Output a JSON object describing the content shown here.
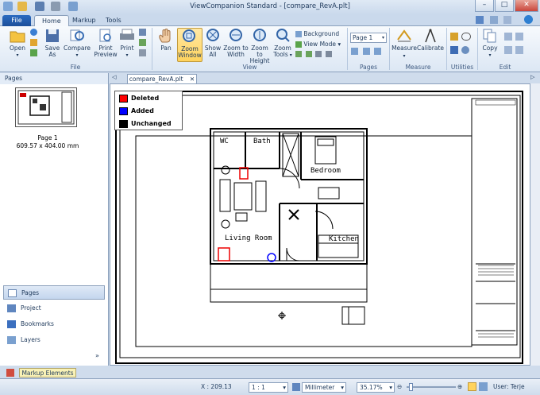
{
  "window": {
    "title": "ViewCompanion Standard - [compare_RevA.plt]"
  },
  "tabs": {
    "file": "File",
    "home": "Home",
    "markup": "Markup",
    "tools": "Tools"
  },
  "ribbon": {
    "file_group": {
      "label": "File",
      "open": "Open",
      "save_as": "Save As",
      "compare": "Compare",
      "print_preview": "Print Preview",
      "print": "Print"
    },
    "view_group": {
      "label": "View",
      "pan": "Pan",
      "zoom_window": "Zoom Window",
      "show_all": "Show All",
      "zoom_to_width": "Zoom to Width",
      "zoom_to_height": "Zoom to Height",
      "zoom_tools": "Zoom Tools",
      "background": "Background",
      "view_mode": "View Mode"
    },
    "pages_group": {
      "label": "Pages",
      "page_select": "Page 1"
    },
    "measure_group": {
      "label": "Measure",
      "measure": "Measure",
      "calibrate": "Calibrate"
    },
    "utilities_group": {
      "label": "Utilities"
    },
    "edit_group": {
      "label": "Edit",
      "copy": "Copy"
    }
  },
  "left_panel": {
    "header": "Pages",
    "thumb_label": "Page 1",
    "thumb_size": "609.57 x 404.00 mm",
    "nav": {
      "pages": "Pages",
      "project": "Project",
      "bookmarks": "Bookmarks",
      "layers": "Layers"
    }
  },
  "document_tab": "compare_RevA.plt",
  "legend": {
    "deleted": "Deleted",
    "added": "Added",
    "unchanged": "Unchanged"
  },
  "drawing_labels": {
    "wc": "WC",
    "bath": "Bath",
    "bedroom": "Bedroom",
    "living_room": "Living Room",
    "kitchen": "Kitchen"
  },
  "bottom_tab": "Markup Elements",
  "status_bar": {
    "x": "X : 209.13",
    "scale": "1 : 1",
    "unit": "Millimeter",
    "zoom": "35.17%",
    "user": "User: Terje"
  },
  "colors": {
    "deleted": "#ff0000",
    "added": "#0000ff",
    "unchanged": "#000000"
  }
}
